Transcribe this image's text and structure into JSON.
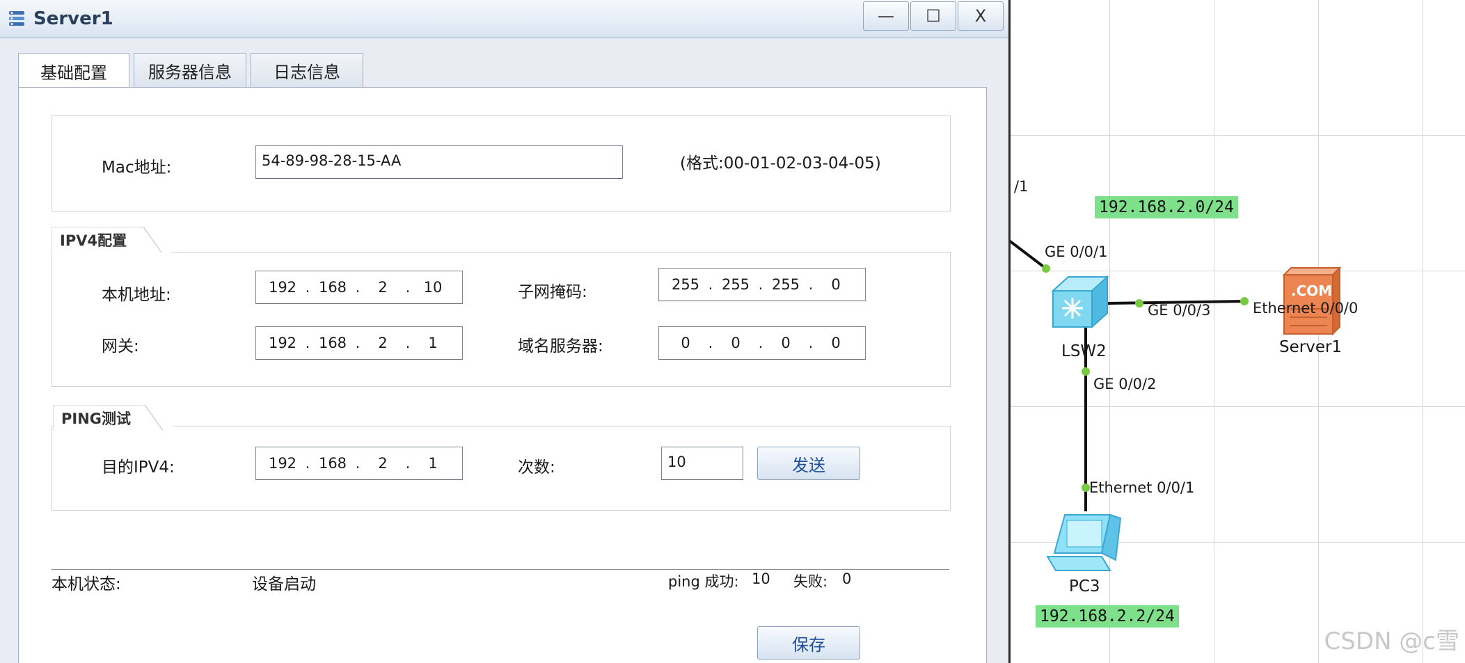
{
  "window": {
    "title": "Server1",
    "controls": {
      "minimize": "—",
      "maximize": "☐",
      "close": "X"
    }
  },
  "tabs": [
    {
      "label": "基础配置",
      "active": true
    },
    {
      "label": "服务器信息",
      "active": false
    },
    {
      "label": "日志信息",
      "active": false
    }
  ],
  "mac": {
    "label": "Mac地址:",
    "value": "54-89-98-28-15-AA",
    "format_hint": "(格式:00-01-02-03-04-05)"
  },
  "ipv4": {
    "group_title": "IPV4配置",
    "host_label": "本机地址:",
    "host": [
      "192",
      "168",
      "2",
      "10"
    ],
    "mask_label": "子网掩码:",
    "mask": [
      "255",
      "255",
      "255",
      "0"
    ],
    "gateway_label": "网关:",
    "gateway": [
      "192",
      "168",
      "2",
      "1"
    ],
    "dns_label": "域名服务器:",
    "dns": [
      "0",
      "0",
      "0",
      "0"
    ]
  },
  "ping": {
    "group_title": "PING测试",
    "dest_label": "目的IPV4:",
    "dest": [
      "192",
      "168",
      "2",
      "1"
    ],
    "count_label": "次数:",
    "count": "10",
    "send_button": "发送"
  },
  "status": {
    "label": "本机状态:",
    "value": "设备启动",
    "ping_success_label": "ping 成功:",
    "ping_success": "10",
    "fail_label": "失败:",
    "fail": "0"
  },
  "save_button": "保存",
  "topology": {
    "partial_port_label": "/1",
    "network_badge": "192.168.2.0/24",
    "pc_badge": "192.168.2.2/24",
    "switch": {
      "name": "LSW2",
      "ports": [
        "GE 0/0/1",
        "GE 0/0/3",
        "GE 0/0/2"
      ]
    },
    "server": {
      "name": "Server1",
      "port": "Ethernet 0/0/0",
      "icon_text": ".COM"
    },
    "pc": {
      "name": "PC3",
      "port": "Ethernet 0/0/1"
    },
    "link_color": "#111111",
    "port_dot_color": "#7ac943"
  },
  "watermark": "CSDN @c雪"
}
